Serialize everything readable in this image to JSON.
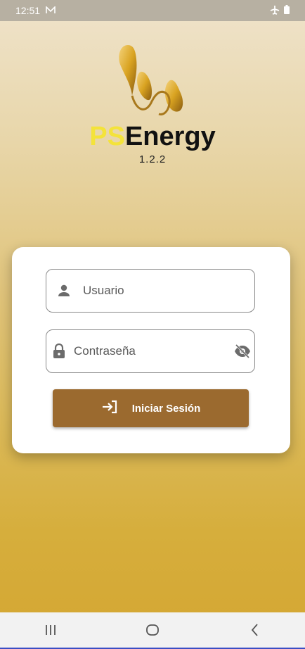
{
  "status_bar": {
    "time": "12:51",
    "icons": [
      "mail-icon",
      "airplane-icon",
      "battery-icon"
    ]
  },
  "brand": {
    "ps": "PS",
    "energy": "Energy",
    "version": "1.2.2"
  },
  "login": {
    "username_placeholder": "Usuario",
    "password_placeholder": "Contraseña",
    "submit_label": "Iniciar Sesión"
  },
  "nav": {
    "icons": [
      "recent-apps-icon",
      "home-icon",
      "back-icon"
    ]
  },
  "colors": {
    "button": "#9b6a2f",
    "brand_yellow": "#f4e33a",
    "logo_gold": "#d9a321"
  }
}
